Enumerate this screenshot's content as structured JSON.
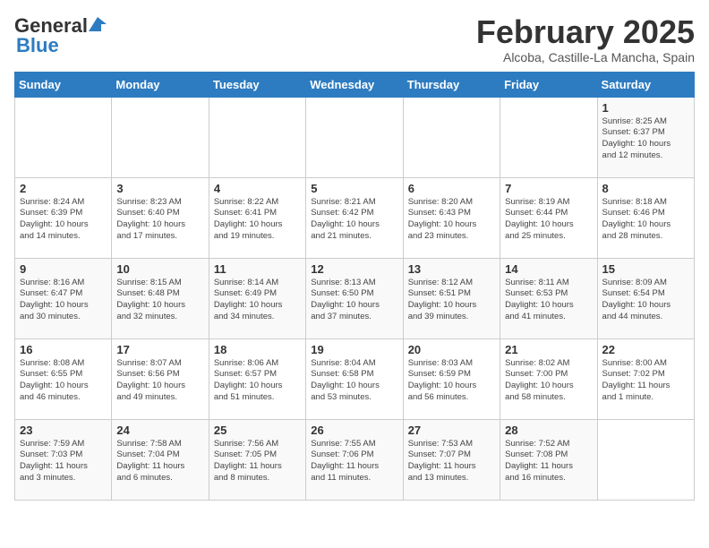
{
  "logo": {
    "general": "General",
    "blue": "Blue"
  },
  "header": {
    "title": "February 2025",
    "subtitle": "Alcoba, Castille-La Mancha, Spain"
  },
  "weekdays": [
    "Sunday",
    "Monday",
    "Tuesday",
    "Wednesday",
    "Thursday",
    "Friday",
    "Saturday"
  ],
  "weeks": [
    [
      {
        "day": "",
        "info": ""
      },
      {
        "day": "",
        "info": ""
      },
      {
        "day": "",
        "info": ""
      },
      {
        "day": "",
        "info": ""
      },
      {
        "day": "",
        "info": ""
      },
      {
        "day": "",
        "info": ""
      },
      {
        "day": "1",
        "info": "Sunrise: 8:25 AM\nSunset: 6:37 PM\nDaylight: 10 hours\nand 12 minutes."
      }
    ],
    [
      {
        "day": "2",
        "info": "Sunrise: 8:24 AM\nSunset: 6:39 PM\nDaylight: 10 hours\nand 14 minutes."
      },
      {
        "day": "3",
        "info": "Sunrise: 8:23 AM\nSunset: 6:40 PM\nDaylight: 10 hours\nand 17 minutes."
      },
      {
        "day": "4",
        "info": "Sunrise: 8:22 AM\nSunset: 6:41 PM\nDaylight: 10 hours\nand 19 minutes."
      },
      {
        "day": "5",
        "info": "Sunrise: 8:21 AM\nSunset: 6:42 PM\nDaylight: 10 hours\nand 21 minutes."
      },
      {
        "day": "6",
        "info": "Sunrise: 8:20 AM\nSunset: 6:43 PM\nDaylight: 10 hours\nand 23 minutes."
      },
      {
        "day": "7",
        "info": "Sunrise: 8:19 AM\nSunset: 6:44 PM\nDaylight: 10 hours\nand 25 minutes."
      },
      {
        "day": "8",
        "info": "Sunrise: 8:18 AM\nSunset: 6:46 PM\nDaylight: 10 hours\nand 28 minutes."
      }
    ],
    [
      {
        "day": "9",
        "info": "Sunrise: 8:16 AM\nSunset: 6:47 PM\nDaylight: 10 hours\nand 30 minutes."
      },
      {
        "day": "10",
        "info": "Sunrise: 8:15 AM\nSunset: 6:48 PM\nDaylight: 10 hours\nand 32 minutes."
      },
      {
        "day": "11",
        "info": "Sunrise: 8:14 AM\nSunset: 6:49 PM\nDaylight: 10 hours\nand 34 minutes."
      },
      {
        "day": "12",
        "info": "Sunrise: 8:13 AM\nSunset: 6:50 PM\nDaylight: 10 hours\nand 37 minutes."
      },
      {
        "day": "13",
        "info": "Sunrise: 8:12 AM\nSunset: 6:51 PM\nDaylight: 10 hours\nand 39 minutes."
      },
      {
        "day": "14",
        "info": "Sunrise: 8:11 AM\nSunset: 6:53 PM\nDaylight: 10 hours\nand 41 minutes."
      },
      {
        "day": "15",
        "info": "Sunrise: 8:09 AM\nSunset: 6:54 PM\nDaylight: 10 hours\nand 44 minutes."
      }
    ],
    [
      {
        "day": "16",
        "info": "Sunrise: 8:08 AM\nSunset: 6:55 PM\nDaylight: 10 hours\nand 46 minutes."
      },
      {
        "day": "17",
        "info": "Sunrise: 8:07 AM\nSunset: 6:56 PM\nDaylight: 10 hours\nand 49 minutes."
      },
      {
        "day": "18",
        "info": "Sunrise: 8:06 AM\nSunset: 6:57 PM\nDaylight: 10 hours\nand 51 minutes."
      },
      {
        "day": "19",
        "info": "Sunrise: 8:04 AM\nSunset: 6:58 PM\nDaylight: 10 hours\nand 53 minutes."
      },
      {
        "day": "20",
        "info": "Sunrise: 8:03 AM\nSunset: 6:59 PM\nDaylight: 10 hours\nand 56 minutes."
      },
      {
        "day": "21",
        "info": "Sunrise: 8:02 AM\nSunset: 7:00 PM\nDaylight: 10 hours\nand 58 minutes."
      },
      {
        "day": "22",
        "info": "Sunrise: 8:00 AM\nSunset: 7:02 PM\nDaylight: 11 hours\nand 1 minute."
      }
    ],
    [
      {
        "day": "23",
        "info": "Sunrise: 7:59 AM\nSunset: 7:03 PM\nDaylight: 11 hours\nand 3 minutes."
      },
      {
        "day": "24",
        "info": "Sunrise: 7:58 AM\nSunset: 7:04 PM\nDaylight: 11 hours\nand 6 minutes."
      },
      {
        "day": "25",
        "info": "Sunrise: 7:56 AM\nSunset: 7:05 PM\nDaylight: 11 hours\nand 8 minutes."
      },
      {
        "day": "26",
        "info": "Sunrise: 7:55 AM\nSunset: 7:06 PM\nDaylight: 11 hours\nand 11 minutes."
      },
      {
        "day": "27",
        "info": "Sunrise: 7:53 AM\nSunset: 7:07 PM\nDaylight: 11 hours\nand 13 minutes."
      },
      {
        "day": "28",
        "info": "Sunrise: 7:52 AM\nSunset: 7:08 PM\nDaylight: 11 hours\nand 16 minutes."
      },
      {
        "day": "",
        "info": ""
      }
    ]
  ]
}
